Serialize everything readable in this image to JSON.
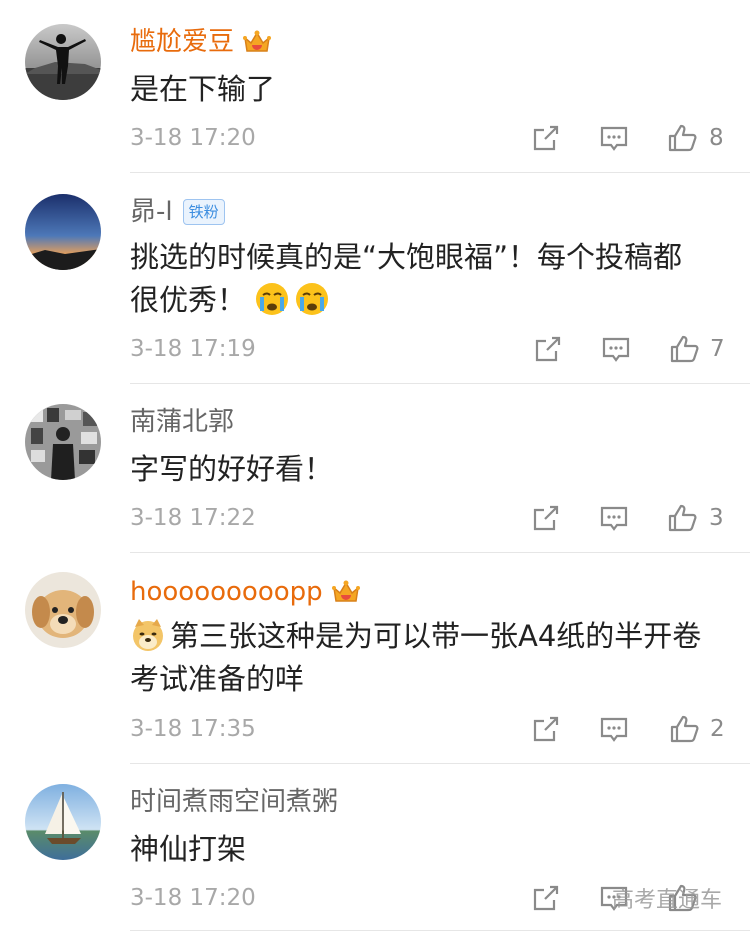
{
  "comments": [
    {
      "username": "尴尬爱豆",
      "text": "是在下输了",
      "time": "3-18 17:20",
      "likes": "8",
      "badge": "crown-icon",
      "name_color": "#e86b0c"
    },
    {
      "username": "昴-l",
      "badge_label": "铁粉",
      "text_line1": "挑选的时候真的是“大饱眼福”！每个投稿都",
      "text_line2": "很优秀！",
      "trailing_emoji": [
        "crying-face-icon",
        "crying-face-icon"
      ],
      "time": "3-18 17:19",
      "likes": "7"
    },
    {
      "username": "南蒲北郭",
      "text": "字写的好好看！",
      "time": "3-18 17:22",
      "likes": "3"
    },
    {
      "username": "hooooooooopp",
      "badge": "crown-icon",
      "name_color": "#e86b0c",
      "leading_emoji": "doge-icon",
      "text_line1": "第三张这种是为可以带一张A4纸的半开卷",
      "text_line2": "考试准备的咩",
      "time": "3-18 17:35",
      "likes": "2"
    },
    {
      "username": "时间煮雨空间煮粥",
      "text": "神仙打架",
      "time": "3-18 17:20",
      "likes": ""
    }
  ],
  "watermark": "高考直通车",
  "colors": {
    "vip_name": "#e86b0c",
    "normal_name": "#666666",
    "meta": "#a8a8a8",
    "fan_badge": "#3d8ee0"
  }
}
